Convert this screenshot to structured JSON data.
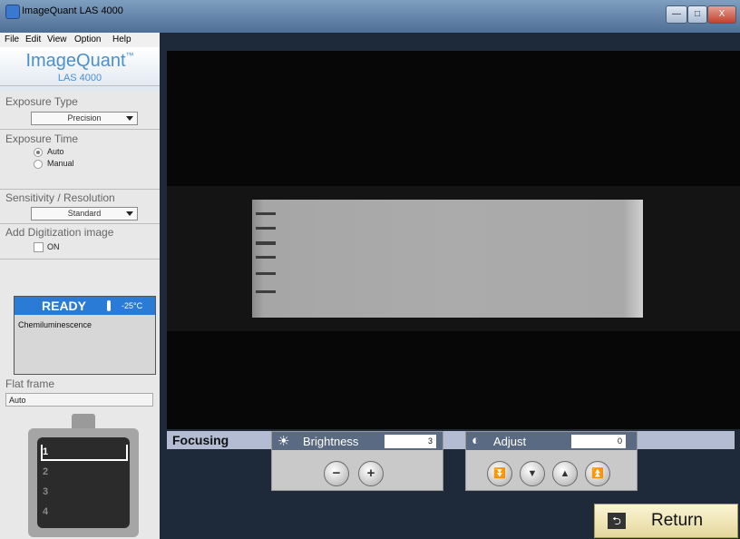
{
  "window": {
    "title": "ImageQuant LAS 4000",
    "minimize": "—",
    "maximize": "□",
    "close": "X"
  },
  "menu": [
    "File",
    "Edit",
    "View",
    "Option",
    "Help"
  ],
  "logo": {
    "brand": "ImageQuant",
    "tm": "™",
    "model": "LAS 4000"
  },
  "exposure_type": {
    "title": "Exposure Type",
    "value": "Precision"
  },
  "exposure_time": {
    "title": "Exposure Time",
    "options": [
      "Auto",
      "Manual"
    ],
    "selected": "Auto"
  },
  "sensitivity": {
    "title": "Sensitivity / Resolution",
    "value": "Standard"
  },
  "digitization": {
    "title": "Add Digitization image",
    "checkbox_label": "ON",
    "checked": false
  },
  "status": {
    "state": "READY",
    "temperature": "-25°C",
    "mode": "Chemiluminescence",
    "header_color": "#2a7bd6"
  },
  "flat_frame": {
    "title": "Flat frame",
    "value": "Auto"
  },
  "tray": {
    "slots": [
      "1",
      "2",
      "3",
      "4"
    ],
    "selected": "1"
  },
  "focusing": {
    "label": "Focusing"
  },
  "brightness": {
    "label": "Brightness",
    "value": "3",
    "minus": "−",
    "plus": "+",
    "icon": "sun-icon"
  },
  "adjust": {
    "label": "Adjust",
    "value": "0",
    "buttons": [
      "⏬",
      "▼",
      "▲",
      "⏫"
    ],
    "icon": "contrast-icon"
  },
  "return_button": {
    "label": "Return",
    "icon": "return-icon",
    "glyph": "⮌"
  }
}
